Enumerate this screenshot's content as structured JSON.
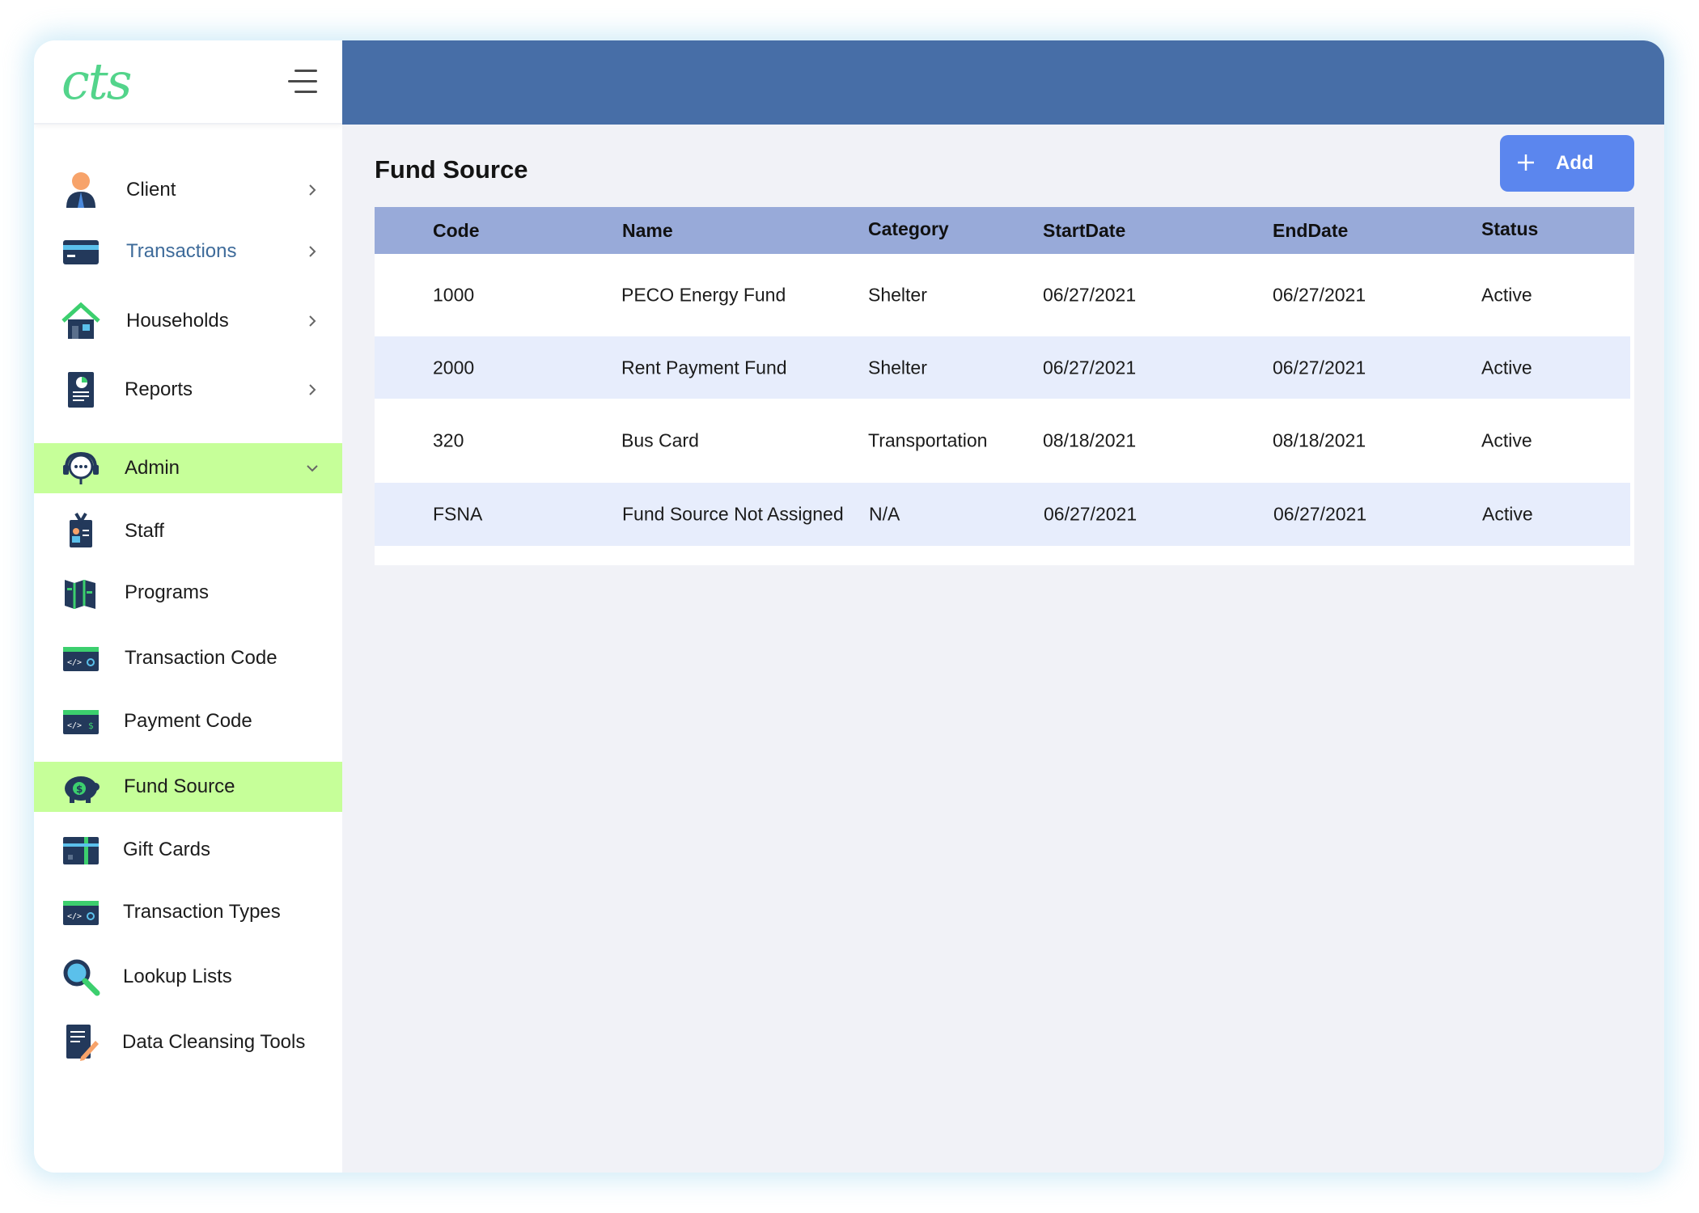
{
  "app": {
    "logo_text": "cts"
  },
  "sidebar": {
    "items": [
      {
        "label": "Client",
        "icon": "client-icon"
      },
      {
        "label": "Transactions",
        "icon": "card-icon"
      },
      {
        "label": "Households",
        "icon": "house-icon"
      },
      {
        "label": "Reports",
        "icon": "report-icon"
      },
      {
        "label": "Admin",
        "icon": "headset-icon"
      },
      {
        "label": "Staff",
        "icon": "staff-badge-icon"
      },
      {
        "label": "Programs",
        "icon": "map-book-icon"
      },
      {
        "label": "Transaction Code",
        "icon": "code-window-icon"
      },
      {
        "label": "Payment Code",
        "icon": "code-window-icon"
      },
      {
        "label": "Fund Source",
        "icon": "piggy-bank-icon"
      },
      {
        "label": "Gift Cards",
        "icon": "gift-card-icon"
      },
      {
        "label": "Transaction Types",
        "icon": "code-window-icon"
      },
      {
        "label": "Lookup Lists",
        "icon": "magnifier-icon"
      },
      {
        "label": "Data Cleansing Tools",
        "icon": "edit-document-icon"
      }
    ],
    "active_items": [
      "Admin",
      "Fund Source"
    ]
  },
  "page": {
    "title": "Fund Source",
    "add_label": "Add"
  },
  "table": {
    "headers": [
      "Code",
      "Name",
      "Category",
      "StartDate",
      "EndDate",
      "Status"
    ],
    "rows": [
      [
        "1000",
        "PECO Energy Fund",
        "Shelter",
        "06/27/2021",
        "06/27/2021",
        "Active"
      ],
      [
        "2000",
        "Rent Payment Fund",
        "Shelter",
        "06/27/2021",
        "06/27/2021",
        "Active"
      ],
      [
        "320",
        "Bus Card",
        "Transportation",
        "08/18/2021",
        "08/18/2021",
        "Active"
      ],
      [
        "FSNA",
        "Fund Source Not Assigned",
        "N/A",
        "06/27/2021",
        "06/27/2021",
        "Active"
      ]
    ]
  },
  "colors": {
    "topbar": "#476ea7",
    "active_nav": "#c6ff99",
    "table_header": "#98aad9",
    "alt_row": "#e7edfc",
    "add_button": "#5b86ee",
    "logo": "#53d48b"
  }
}
